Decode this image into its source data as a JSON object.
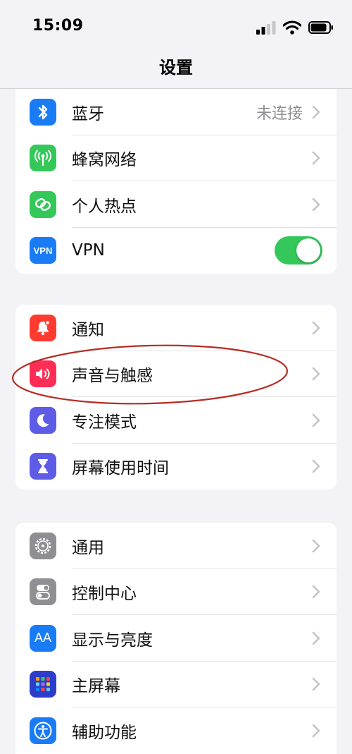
{
  "status_bar": {
    "time": "15:09"
  },
  "nav": {
    "title": "设置"
  },
  "groups": [
    {
      "rows": [
        {
          "label": "蓝牙",
          "value": "未连接",
          "icon": "bluetooth-icon",
          "color": "#1a7cf5"
        },
        {
          "label": "蜂窝网络",
          "icon": "cellular-antenna-icon",
          "color": "#34c759"
        },
        {
          "label": "个人热点",
          "icon": "hotspot-link-icon",
          "color": "#34c759"
        },
        {
          "label": "VPN",
          "icon": "vpn-icon",
          "icon_text": "VPN",
          "color": "#1a7cf5",
          "toggle_on": true
        }
      ]
    },
    {
      "rows": [
        {
          "label": "通知",
          "icon": "bell-icon",
          "color": "#ff3b30"
        },
        {
          "label": "声音与触感",
          "icon": "speaker-icon",
          "color": "#ff2d55",
          "highlighted": true
        },
        {
          "label": "专注模式",
          "icon": "moon-icon",
          "color": "#5e5ce6"
        },
        {
          "label": "屏幕使用时间",
          "icon": "hourglass-icon",
          "color": "#5e5ce6"
        }
      ]
    },
    {
      "rows": [
        {
          "label": "通用",
          "icon": "gear-icon",
          "color": "#8e8e93"
        },
        {
          "label": "控制中心",
          "icon": "toggles-icon",
          "color": "#8e8e93"
        },
        {
          "label": "显示与亮度",
          "icon": "text-size-icon",
          "icon_text": "AA",
          "color": "#1a7cf5"
        },
        {
          "label": "主屏幕",
          "icon": "home-grid-icon",
          "color": "#2c3ec9"
        },
        {
          "label": "辅助功能",
          "icon": "accessibility-icon",
          "color": "#1a7cf5"
        }
      ]
    }
  ],
  "annotation": {
    "color": "#b72c22"
  }
}
